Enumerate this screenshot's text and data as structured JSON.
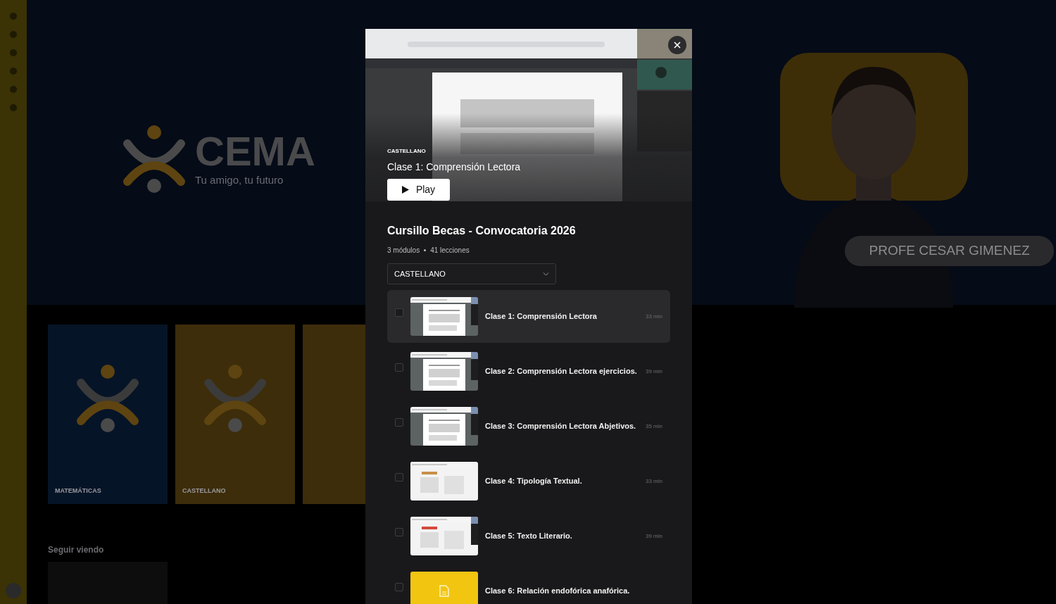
{
  "background": {
    "brand": {
      "name": "CEMA",
      "tagline": "Tu amigo, tu futuro"
    },
    "teacher_name": "PROFE CESAR GIMENEZ",
    "cards": [
      {
        "label": "MATEMÁTICAS",
        "color": "#061427"
      },
      {
        "label": "CASTELLANO",
        "color": "#3d2d0a"
      }
    ],
    "section_title": "Seguir viendo"
  },
  "modal": {
    "hero": {
      "module": "CASTELLANO",
      "title": "Clase 1: Comprensión Lectora",
      "play_label": "Play"
    },
    "course": {
      "title": "Cursillo Becas - Convocatoria 2026",
      "modules": "3 módulos",
      "lessons": "41 lecciones"
    },
    "module_select": {
      "value": "CASTELLANO"
    },
    "lessons": [
      {
        "kind": "video",
        "title": "Clase 1: Comprensión Lectora",
        "duration": "33 min",
        "selected": true,
        "checked": false
      },
      {
        "kind": "video",
        "title": "Clase 2: Comprensión Lectora ejercicios.",
        "duration": "39 min",
        "selected": false,
        "checked": false
      },
      {
        "kind": "video",
        "title": "Clase 3: Comprensión Lectora Abjetivos.",
        "duration": "35 min",
        "selected": false,
        "checked": false
      },
      {
        "kind": "video",
        "title": "Clase 4: Tipología Textual.",
        "duration": "33 min",
        "selected": false,
        "checked": false
      },
      {
        "kind": "video",
        "title": "Clase 5: Texto Literario.",
        "duration": "39 min",
        "selected": false,
        "checked": false
      },
      {
        "kind": "document",
        "title": "Clase 6: Relación endofórica anafórica.",
        "selected": false,
        "checked": false
      }
    ]
  }
}
